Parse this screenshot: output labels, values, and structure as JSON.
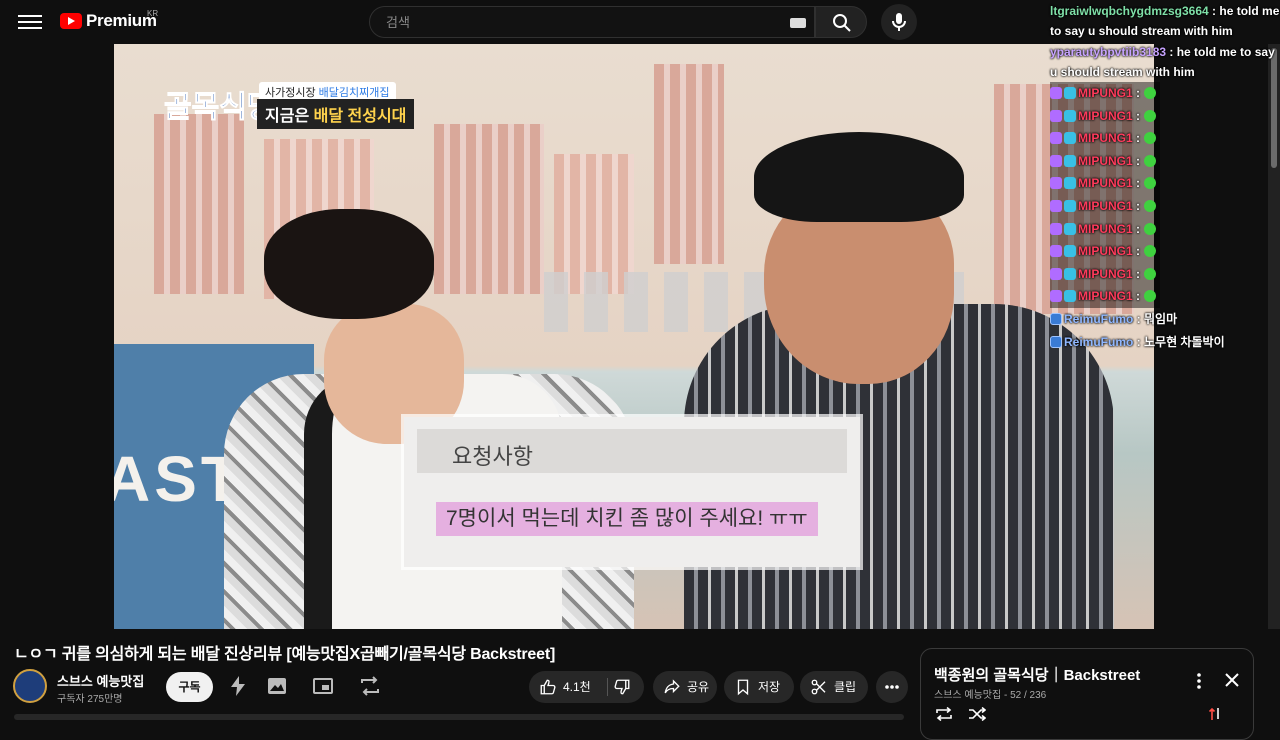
{
  "header": {
    "logo_text": "Premium",
    "region": "KR",
    "search_placeholder": "검색"
  },
  "video": {
    "show_logo": "골목식당",
    "tag_top_prefix": "사가정시장",
    "tag_top_highlight": "배달김치찌개집",
    "tag_main_prefix": "지금은",
    "tag_main_highlight": "배달 전성시대",
    "wall_text": "ASTI",
    "caption_heading": "요청사항",
    "caption_text": "7명이서 먹는데 치킨 좀 많이 주세요! ㅠㅠ"
  },
  "chat": {
    "messages": [
      {
        "author": "ltgraiwlwqbchygdmzsg3664",
        "sep": " : ",
        "text": "he told me to say u should stream with him"
      },
      {
        "author": "yparautybpvtiib3183",
        "sep": " : ",
        "text": "he told me to say u should stream with him"
      },
      {
        "author": "MIPUNG1",
        "sep": " :"
      },
      {
        "author": "MIPUNG1",
        "sep": " :"
      },
      {
        "author": "MIPUNG1",
        "sep": " :"
      },
      {
        "author": "MIPUNG1",
        "sep": " :"
      },
      {
        "author": "MIPUNG1",
        "sep": " :"
      },
      {
        "author": "MIPUNG1",
        "sep": " :"
      },
      {
        "author": "MIPUNG1",
        "sep": " :"
      },
      {
        "author": "MIPUNG1",
        "sep": " :"
      },
      {
        "author": "MIPUNG1",
        "sep": " :"
      },
      {
        "author": "MIPUNG1",
        "sep": " :"
      },
      {
        "author": "ReimuFumo",
        "sep": " : ",
        "text": "뭐임마"
      },
      {
        "author": "ReimuFumo",
        "sep": " : ",
        "text": "노무현 차돌박이"
      }
    ]
  },
  "info": {
    "title": "ㄴㅇㄱ 귀를 의심하게 되는 배달 진상리뷰 [예능맛집X곱빼기/골목식당 Backstreet]",
    "channel_name": "스브스 예능맛집",
    "subscribers": "구독자 275만명",
    "subscribe_label": "구독",
    "like_count": "4.1천",
    "share_label": "공유",
    "save_label": "저장",
    "clip_label": "클립"
  },
  "playlist": {
    "title": "백종원의 골목식당｜Backstreet",
    "channel": "스브스 예능맛집",
    "position": "52 / 236"
  },
  "colors": {
    "accent": "#ff0000",
    "background": "#0f0f0f",
    "chat_mipung": "#ff3b5c"
  }
}
